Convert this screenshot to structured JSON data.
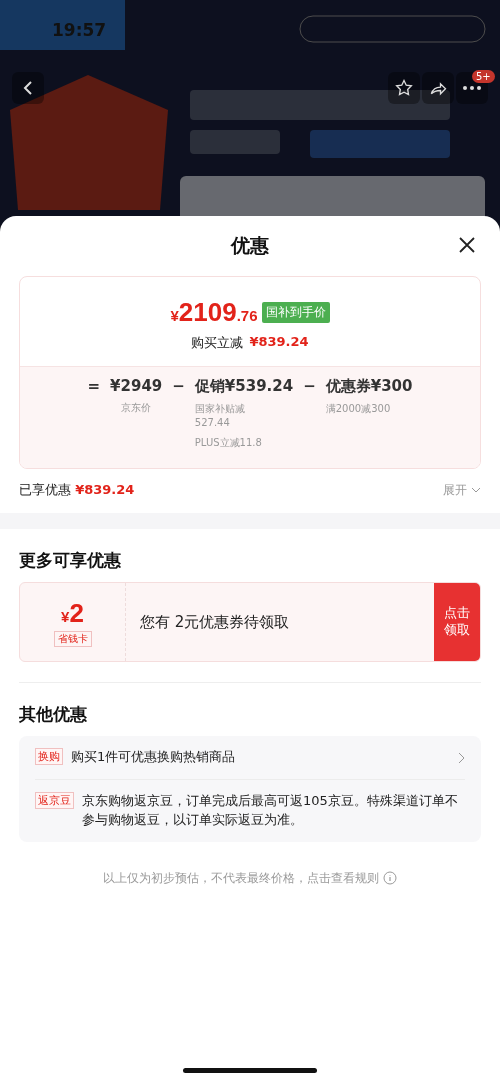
{
  "status_bar": {
    "time": "19:57"
  },
  "product_header": {
    "kind": "picture",
    "cart_badge": "5+"
  },
  "sheet": {
    "title": "优惠",
    "price_card": {
      "currency": "¥",
      "price_main": "2109",
      "price_decimal": ".76",
      "price_tag": "国补到手价",
      "saving_label": "购买立减",
      "saving_amount": "¥839.24",
      "formula": [
        {
          "kind": "operator",
          "text": "="
        },
        {
          "kind": "term",
          "text": "¥2949",
          "notes": [
            "京东价"
          ]
        },
        {
          "kind": "operator",
          "text": "−"
        },
        {
          "kind": "term",
          "text": "促销¥539.24",
          "notes": [
            "国家补贴减\n527.44",
            "PLUS立减11.8"
          ]
        },
        {
          "kind": "operator",
          "text": "−"
        },
        {
          "kind": "term",
          "text": "优惠券¥300",
          "notes": [
            "满2000减300"
          ]
        }
      ]
    },
    "enjoyed": {
      "label": "已享优惠",
      "amount": "¥839.24",
      "toggle": "展开"
    },
    "more_section": {
      "title": "更多可享优惠",
      "coupon": {
        "currency": "¥",
        "amount": "2",
        "tag": "省钱卡",
        "text": "您有 2元优惠券待领取",
        "button": "点击领取"
      }
    },
    "other_section": {
      "title": "其他优惠",
      "items": [
        {
          "tag": "换购",
          "text": "购买1件可优惠换购热销商品",
          "has_arrow": true
        },
        {
          "tag": "返京豆",
          "text": "京东购物返京豆，订单完成后最高可返105京豆。特殊渠道订单不参与购物返豆，以订单实际返豆为准。",
          "has_arrow": false
        }
      ]
    },
    "footer_note": "以上仅为初步预估，不代表最终价格，点击查看规则"
  }
}
